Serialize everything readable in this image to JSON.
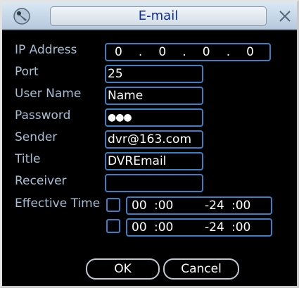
{
  "window": {
    "title": "E-mail",
    "icon": "satellite-dish-icon",
    "close_icon": "close-x-icon"
  },
  "form": {
    "ip_address": {
      "label": "IP Address",
      "octets": [
        "0",
        "0",
        "0",
        "0"
      ],
      "dots": [
        ".",
        ".",
        "."
      ]
    },
    "port": {
      "label": "Port",
      "value": "25"
    },
    "user_name": {
      "label": "User Name",
      "value": "Name"
    },
    "password": {
      "label": "Password",
      "value": "●●●"
    },
    "sender": {
      "label": "Sender",
      "value": "dvr@163.com"
    },
    "title": {
      "label": "Title",
      "value": "DVREmail"
    },
    "receiver": {
      "label": "Receiver",
      "value": ""
    },
    "effective_time": {
      "label": "Effective Time",
      "periods": [
        {
          "enabled": false,
          "start_h": "00",
          "start_m": ":00",
          "end_h": "-24",
          "end_m": ":00"
        },
        {
          "enabled": false,
          "start_h": "00",
          "start_m": ":00",
          "end_h": "-24",
          "end_m": ":00"
        }
      ]
    }
  },
  "buttons": {
    "ok": "OK",
    "cancel": "Cancel"
  },
  "colors": {
    "label": "#a7bfd4",
    "field_border": "#3d7fc4",
    "title_text": "#0b2f8a"
  }
}
